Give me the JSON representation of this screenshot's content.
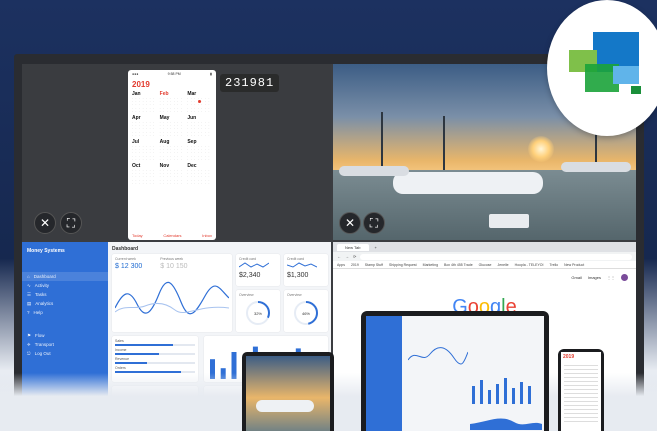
{
  "colors": {
    "background": "#1a2c54",
    "accent": "#2f6fd6",
    "calendar_red": "#e23b2e"
  },
  "calendar": {
    "year": "2019",
    "pin": "231981",
    "months": [
      "Jan",
      "Feb",
      "Mar",
      "Apr",
      "May",
      "Jun",
      "Jul",
      "Aug",
      "Sep",
      "Oct",
      "Nov",
      "Dec"
    ],
    "footer": {
      "today": "Today",
      "calendars": "Calendars",
      "inbox": "Inbox"
    }
  },
  "dashboard": {
    "brand": "Money Systems",
    "title": "Dashboard",
    "nav": [
      "Dashboard",
      "Activity",
      "Tasks",
      "Analytics",
      "Help",
      "Flow",
      "Transport",
      "Log Out"
    ],
    "cards": [
      {
        "label": "Current week",
        "value": "$ 12 300"
      },
      {
        "label": "Previous week",
        "value": "$ 10 150"
      },
      {
        "label": "Credit card",
        "value": "$2,340"
      },
      {
        "label": "Credit card",
        "value": "$1,300"
      }
    ],
    "gauges": [
      {
        "label": "Overview",
        "value": "32%"
      },
      {
        "label": "Overview",
        "value": "46%"
      }
    ],
    "progress": [
      {
        "label": "Sales",
        "value": "",
        "fill": 0.72
      },
      {
        "label": "Income",
        "value": "",
        "fill": 0.55
      },
      {
        "label": "Revenue",
        "value": "",
        "fill": 0.4
      },
      {
        "label": "Orders",
        "value": "",
        "fill": 0.83
      }
    ],
    "bars": [
      0.55,
      0.3,
      0.75,
      0.45,
      0.9,
      0.35,
      0.7,
      0.5,
      0.85,
      0.3,
      0.6
    ]
  },
  "browser": {
    "tab": "New Tab",
    "bookmarks": [
      "Apps",
      "2019",
      "Stamp Stuff",
      "Shipping Request",
      "Marketing",
      "Box 4th 455 Trade",
      "Glucose",
      "Jenelle",
      "Hoopla - TELEYOI",
      "Trello",
      "New Product"
    ],
    "links": [
      "Gmail",
      "Images"
    ],
    "logo": "Google"
  },
  "icons": [
    "close-icon",
    "fullscreen-icon",
    "folder-icon",
    "settings-icon",
    "search-icon"
  ]
}
